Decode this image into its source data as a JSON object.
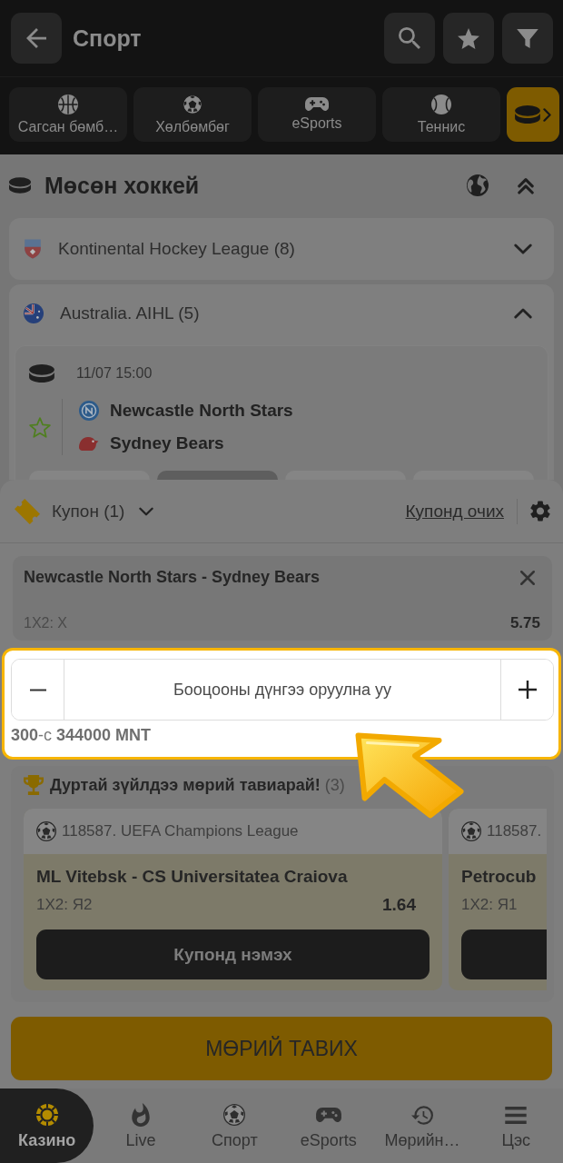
{
  "header": {
    "title": "Спорт"
  },
  "sport_tabs": [
    {
      "label": "Сагсан бөмб…",
      "selected": false
    },
    {
      "label": "Хөлбөмбөг",
      "selected": false
    },
    {
      "label": "eSports",
      "selected": false
    },
    {
      "label": "Теннис",
      "selected": false
    },
    {
      "selected": true
    }
  ],
  "sport": {
    "title": "Мөсөн хоккей",
    "leagues": [
      {
        "name": "Kontinental Hockey League (8)",
        "expanded": false
      },
      {
        "name": "Australia. AIHL (5)",
        "expanded": true,
        "matches": [
          {
            "time": "11/07 15:00",
            "favorite": false,
            "teams": [
              "Newcastle North Stars",
              "Sydney Bears"
            ],
            "odds": [
              {
                "selected": false
              },
              {
                "selected": true
              },
              {
                "selected": false
              },
              {
                "selected": false
              }
            ]
          }
        ]
      }
    ]
  },
  "coupon": {
    "title": "Купон (1)",
    "link": "Купонд очих",
    "bet": {
      "event": "Newcastle North Stars - Sydney Bears",
      "market": "1X2: X",
      "odds": "5.75"
    },
    "stake": {
      "placeholder": "Бооцооны дүнгээ оруулна уу",
      "limits": "**300**-с **344000 MNT**",
      "highlighted": true
    },
    "promo": {
      "title": "**Дуртай зүйлдээ мөрий тавиарай!** (3)",
      "cards": [
        {
          "league": "118587. UEFA Champions League",
          "event": "ML Vitebsk - CS Universitatea Craiova",
          "market": "1X2: Я2",
          "odds": "1.64",
          "button": "Купонд нэмэх"
        },
        {
          "league": "118587.",
          "event": "Petrocub",
          "market": "1X2: Я1"
        }
      ]
    },
    "place_bet_button": "МӨРИЙ ТАВИХ"
  },
  "bottom_nav": [
    {
      "label": "Казино",
      "selected": true
    },
    {
      "label": "Live",
      "selected": false
    },
    {
      "label": "Спорт",
      "selected": false
    },
    {
      "label": "eSports",
      "selected": false
    },
    {
      "label": "Мөрийн…",
      "selected": false
    },
    {
      "label": "Цэс",
      "selected": false
    }
  ]
}
